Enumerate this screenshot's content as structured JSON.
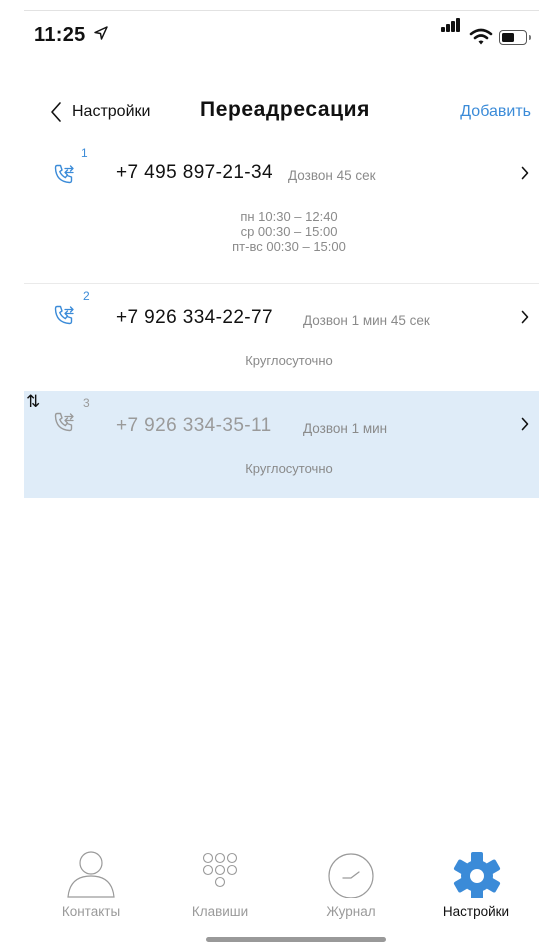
{
  "status": {
    "time": "11:25"
  },
  "nav": {
    "back_label": "Настройки",
    "title": "Переадресация",
    "add_label": "Добавить"
  },
  "rows": [
    {
      "index": "1",
      "number": "+7 495 897-21-34",
      "duration": "Дозвон 45 сек",
      "schedule": [
        "пн 10:30 – 12:40",
        "ср 00:30 – 15:00",
        "пт-вс 00:30 – 15:00"
      ],
      "selected": false
    },
    {
      "index": "2",
      "number": "+7 926 334-22-77",
      "duration": "Дозвон 1 мин 45 сек",
      "schedule": [
        "Круглосуточно"
      ],
      "selected": false
    },
    {
      "index": "3",
      "number": "+7 926 334-35-11",
      "duration": "Дозвон 1 мин",
      "schedule": [
        "Круглосуточно"
      ],
      "selected": true
    }
  ],
  "tabs": [
    {
      "label": "Контакты",
      "icon": "person-icon",
      "active": false
    },
    {
      "label": "Клавиши",
      "icon": "keypad-icon",
      "active": false
    },
    {
      "label": "Журнал",
      "icon": "clock-icon",
      "active": false
    },
    {
      "label": "Настройки",
      "icon": "gear-icon",
      "active": true
    }
  ],
  "colors": {
    "accent": "#3b8bd8",
    "selected_row": "#dfecf8",
    "muted_text": "#8a8a8a"
  }
}
